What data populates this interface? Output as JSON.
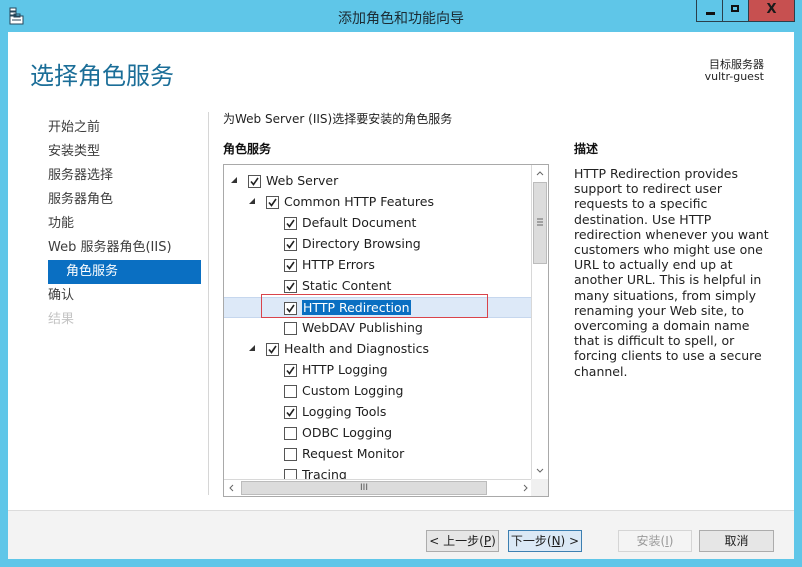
{
  "window": {
    "title": "添加角色和功能向导",
    "controls": {
      "minimize": "–",
      "maximize": "□",
      "close": "X"
    }
  },
  "header": {
    "page_title": "选择角色服务",
    "target_label": "目标服务器",
    "target_value": "vultr-guest"
  },
  "nav": {
    "items": [
      {
        "label": "开始之前",
        "state": "normal"
      },
      {
        "label": "安装类型",
        "state": "normal"
      },
      {
        "label": "服务器选择",
        "state": "normal"
      },
      {
        "label": "服务器角色",
        "state": "normal"
      },
      {
        "label": "功能",
        "state": "normal"
      },
      {
        "label": "Web 服务器角色(IIS)",
        "state": "normal"
      },
      {
        "label": "角色服务",
        "state": "active"
      },
      {
        "label": "确认",
        "state": "normal"
      },
      {
        "label": "结果",
        "state": "disabled"
      }
    ]
  },
  "main": {
    "instruction": "为Web Server (IIS)选择要安装的角色服务",
    "section_title": "角色服务",
    "tree": [
      {
        "label": "Web Server",
        "level": 0,
        "checked": true,
        "expanded": true
      },
      {
        "label": "Common HTTP Features",
        "level": 1,
        "checked": true,
        "expanded": true
      },
      {
        "label": "Default Document",
        "level": 2,
        "checked": true
      },
      {
        "label": "Directory Browsing",
        "level": 2,
        "checked": true
      },
      {
        "label": "HTTP Errors",
        "level": 2,
        "checked": true
      },
      {
        "label": "Static Content",
        "level": 2,
        "checked": true
      },
      {
        "label": "HTTP Redirection",
        "level": 2,
        "checked": true,
        "selected": true
      },
      {
        "label": "WebDAV Publishing",
        "level": 2,
        "checked": false
      },
      {
        "label": "Health and Diagnostics",
        "level": 1,
        "checked": true,
        "expanded": true
      },
      {
        "label": "HTTP Logging",
        "level": 2,
        "checked": true
      },
      {
        "label": "Custom Logging",
        "level": 2,
        "checked": false
      },
      {
        "label": "Logging Tools",
        "level": 2,
        "checked": true
      },
      {
        "label": "ODBC Logging",
        "level": 2,
        "checked": false
      },
      {
        "label": "Request Monitor",
        "level": 2,
        "checked": false
      },
      {
        "label": "Tracing",
        "level": 2,
        "checked": false
      }
    ],
    "scroll": {
      "up": "^",
      "down": "v",
      "left": "<",
      "right": ">",
      "v_grip": "≡",
      "h_grip": "III"
    }
  },
  "description": {
    "title": "描述",
    "text": "HTTP Redirection provides support to redirect user requests to a specific destination. Use HTTP redirection whenever you want customers who might use one URL to actually end up at another URL. This is helpful in many situations, from simply renaming your Web site, to overcoming a domain name that is difficult to spell, or forcing clients to use a secure channel."
  },
  "footer": {
    "prev": {
      "pre": "< 上一步(",
      "key": "P",
      "post": ")"
    },
    "next": {
      "pre": "下一步(",
      "key": "N",
      "post": ") >"
    },
    "install": {
      "pre": "安装(",
      "key": "I",
      "post": ")"
    },
    "cancel": "取消"
  },
  "colors": {
    "frame": "#5fc6e8",
    "close": "#c75050",
    "accent": "#0a6fc2",
    "heading": "#1b6e98",
    "highlight_box": "#d9444b"
  }
}
